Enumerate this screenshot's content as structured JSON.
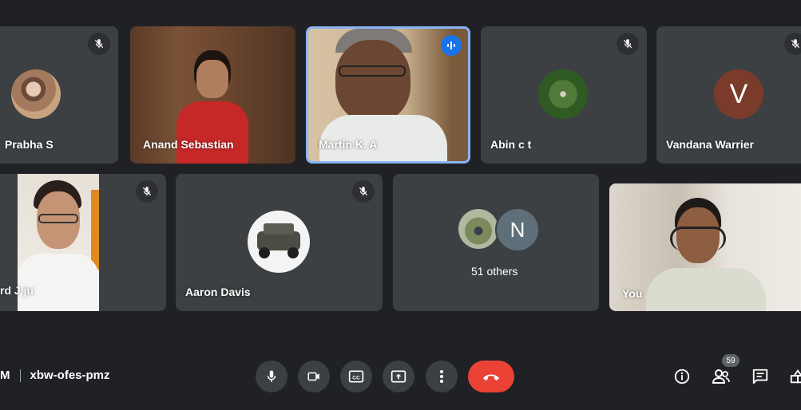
{
  "participants": {
    "prabha": {
      "name": "Prabha S",
      "muted": true
    },
    "anand": {
      "name": "Anand Sebastian",
      "muted": false
    },
    "martin": {
      "name": "Martin K. A",
      "speaking": true
    },
    "abin": {
      "name": "Abin c t",
      "muted": true
    },
    "vandana": {
      "name": "Vandana Warrier",
      "initial": "V",
      "muted": false
    },
    "richard": {
      "name": "rd J ju",
      "muted": true
    },
    "aaron": {
      "name": "Aaron Davis",
      "muted": true
    },
    "others": {
      "label": "51 others",
      "initial": "N"
    },
    "self": {
      "name": "You"
    }
  },
  "meeting": {
    "time_fragment": "M",
    "code": "xbw-ofes-pmz"
  },
  "controls": {
    "mic": "microphone-icon",
    "camera": "camera-icon",
    "captions": "captions-icon",
    "present": "present-screen-icon",
    "more": "more-options-icon",
    "end": "end-call-icon"
  },
  "right_controls": {
    "info": "info-icon",
    "people": "people-icon",
    "people_count": "59",
    "chat": "chat-icon",
    "activities": "activities-icon"
  },
  "colors": {
    "background": "#202124",
    "tile": "#3c4043",
    "speaking_border": "#8ab4f8",
    "speaking_indicator": "#1a73e8",
    "end_call": "#ea4335",
    "vandana_avatar": "#7b3b2a",
    "others_avatar": "#5f6f7a"
  }
}
